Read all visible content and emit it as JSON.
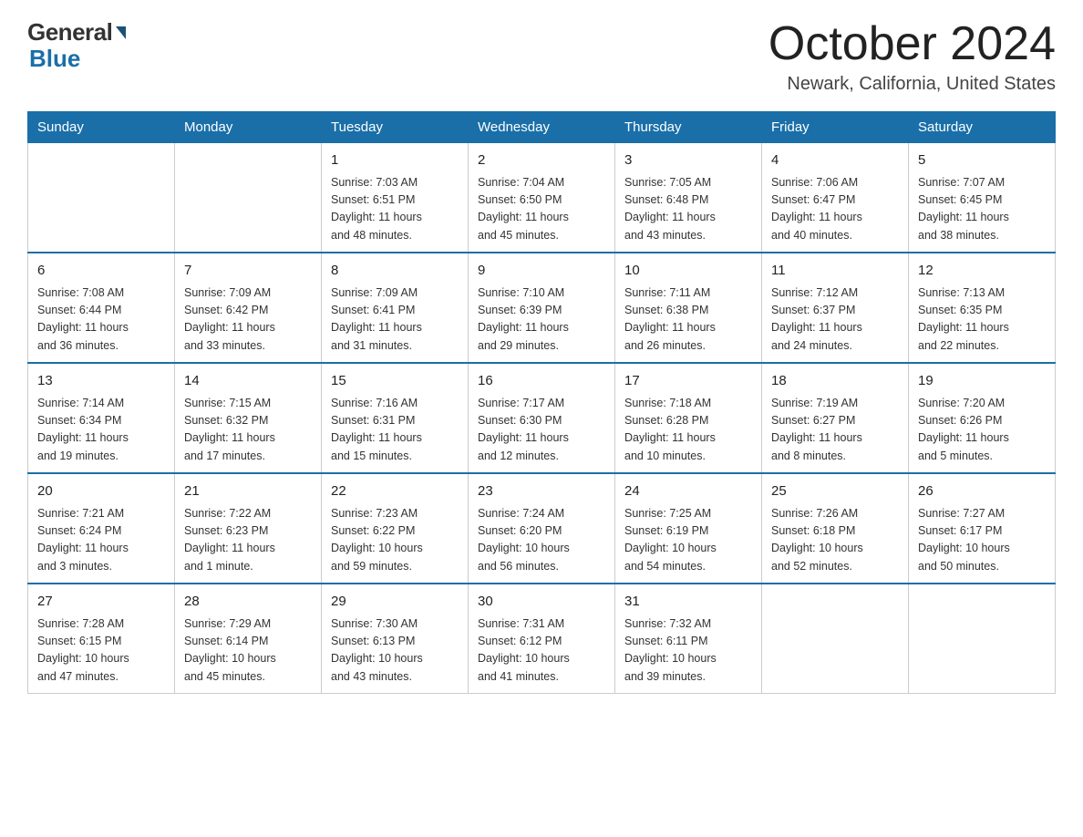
{
  "header": {
    "logo_general": "General",
    "logo_blue": "Blue",
    "month_title": "October 2024",
    "location": "Newark, California, United States"
  },
  "days_of_week": [
    "Sunday",
    "Monday",
    "Tuesday",
    "Wednesday",
    "Thursday",
    "Friday",
    "Saturday"
  ],
  "weeks": [
    [
      {
        "day": "",
        "info": ""
      },
      {
        "day": "",
        "info": ""
      },
      {
        "day": "1",
        "info": "Sunrise: 7:03 AM\nSunset: 6:51 PM\nDaylight: 11 hours\nand 48 minutes."
      },
      {
        "day": "2",
        "info": "Sunrise: 7:04 AM\nSunset: 6:50 PM\nDaylight: 11 hours\nand 45 minutes."
      },
      {
        "day": "3",
        "info": "Sunrise: 7:05 AM\nSunset: 6:48 PM\nDaylight: 11 hours\nand 43 minutes."
      },
      {
        "day": "4",
        "info": "Sunrise: 7:06 AM\nSunset: 6:47 PM\nDaylight: 11 hours\nand 40 minutes."
      },
      {
        "day": "5",
        "info": "Sunrise: 7:07 AM\nSunset: 6:45 PM\nDaylight: 11 hours\nand 38 minutes."
      }
    ],
    [
      {
        "day": "6",
        "info": "Sunrise: 7:08 AM\nSunset: 6:44 PM\nDaylight: 11 hours\nand 36 minutes."
      },
      {
        "day": "7",
        "info": "Sunrise: 7:09 AM\nSunset: 6:42 PM\nDaylight: 11 hours\nand 33 minutes."
      },
      {
        "day": "8",
        "info": "Sunrise: 7:09 AM\nSunset: 6:41 PM\nDaylight: 11 hours\nand 31 minutes."
      },
      {
        "day": "9",
        "info": "Sunrise: 7:10 AM\nSunset: 6:39 PM\nDaylight: 11 hours\nand 29 minutes."
      },
      {
        "day": "10",
        "info": "Sunrise: 7:11 AM\nSunset: 6:38 PM\nDaylight: 11 hours\nand 26 minutes."
      },
      {
        "day": "11",
        "info": "Sunrise: 7:12 AM\nSunset: 6:37 PM\nDaylight: 11 hours\nand 24 minutes."
      },
      {
        "day": "12",
        "info": "Sunrise: 7:13 AM\nSunset: 6:35 PM\nDaylight: 11 hours\nand 22 minutes."
      }
    ],
    [
      {
        "day": "13",
        "info": "Sunrise: 7:14 AM\nSunset: 6:34 PM\nDaylight: 11 hours\nand 19 minutes."
      },
      {
        "day": "14",
        "info": "Sunrise: 7:15 AM\nSunset: 6:32 PM\nDaylight: 11 hours\nand 17 minutes."
      },
      {
        "day": "15",
        "info": "Sunrise: 7:16 AM\nSunset: 6:31 PM\nDaylight: 11 hours\nand 15 minutes."
      },
      {
        "day": "16",
        "info": "Sunrise: 7:17 AM\nSunset: 6:30 PM\nDaylight: 11 hours\nand 12 minutes."
      },
      {
        "day": "17",
        "info": "Sunrise: 7:18 AM\nSunset: 6:28 PM\nDaylight: 11 hours\nand 10 minutes."
      },
      {
        "day": "18",
        "info": "Sunrise: 7:19 AM\nSunset: 6:27 PM\nDaylight: 11 hours\nand 8 minutes."
      },
      {
        "day": "19",
        "info": "Sunrise: 7:20 AM\nSunset: 6:26 PM\nDaylight: 11 hours\nand 5 minutes."
      }
    ],
    [
      {
        "day": "20",
        "info": "Sunrise: 7:21 AM\nSunset: 6:24 PM\nDaylight: 11 hours\nand 3 minutes."
      },
      {
        "day": "21",
        "info": "Sunrise: 7:22 AM\nSunset: 6:23 PM\nDaylight: 11 hours\nand 1 minute."
      },
      {
        "day": "22",
        "info": "Sunrise: 7:23 AM\nSunset: 6:22 PM\nDaylight: 10 hours\nand 59 minutes."
      },
      {
        "day": "23",
        "info": "Sunrise: 7:24 AM\nSunset: 6:20 PM\nDaylight: 10 hours\nand 56 minutes."
      },
      {
        "day": "24",
        "info": "Sunrise: 7:25 AM\nSunset: 6:19 PM\nDaylight: 10 hours\nand 54 minutes."
      },
      {
        "day": "25",
        "info": "Sunrise: 7:26 AM\nSunset: 6:18 PM\nDaylight: 10 hours\nand 52 minutes."
      },
      {
        "day": "26",
        "info": "Sunrise: 7:27 AM\nSunset: 6:17 PM\nDaylight: 10 hours\nand 50 minutes."
      }
    ],
    [
      {
        "day": "27",
        "info": "Sunrise: 7:28 AM\nSunset: 6:15 PM\nDaylight: 10 hours\nand 47 minutes."
      },
      {
        "day": "28",
        "info": "Sunrise: 7:29 AM\nSunset: 6:14 PM\nDaylight: 10 hours\nand 45 minutes."
      },
      {
        "day": "29",
        "info": "Sunrise: 7:30 AM\nSunset: 6:13 PM\nDaylight: 10 hours\nand 43 minutes."
      },
      {
        "day": "30",
        "info": "Sunrise: 7:31 AM\nSunset: 6:12 PM\nDaylight: 10 hours\nand 41 minutes."
      },
      {
        "day": "31",
        "info": "Sunrise: 7:32 AM\nSunset: 6:11 PM\nDaylight: 10 hours\nand 39 minutes."
      },
      {
        "day": "",
        "info": ""
      },
      {
        "day": "",
        "info": ""
      }
    ]
  ]
}
